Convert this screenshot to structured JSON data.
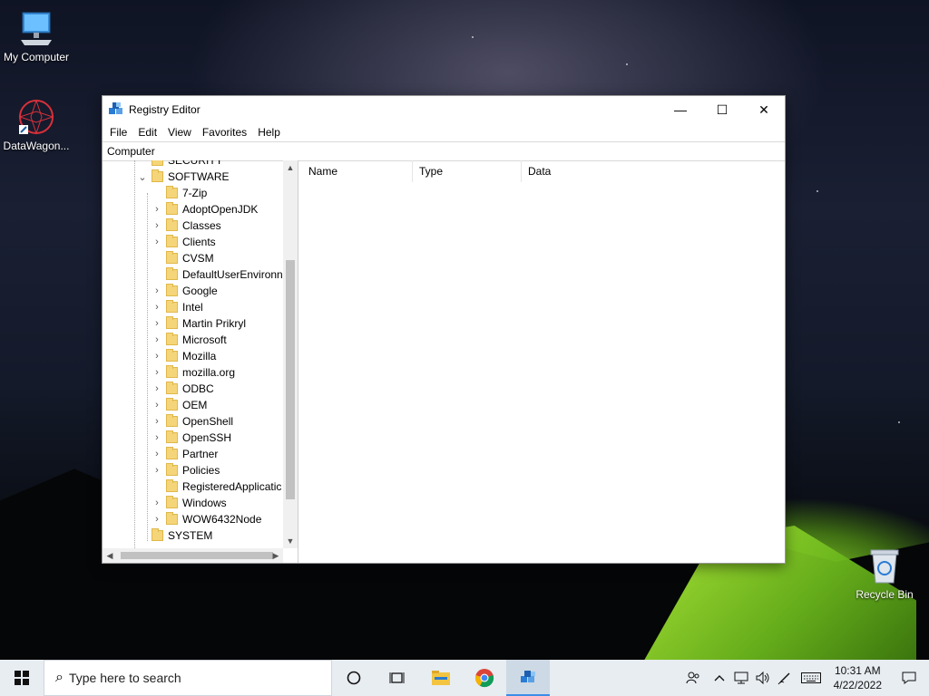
{
  "desktop": {
    "icons": [
      {
        "label": "My Computer",
        "icon": "computer-icon"
      },
      {
        "label": "DataWagon...",
        "icon": "datawagon-icon"
      },
      {
        "label": "Recycle Bin",
        "icon": "recycle-bin-icon"
      }
    ]
  },
  "window": {
    "title": "Registry Editor",
    "controls": {
      "minimize": "—",
      "maximize": "☐",
      "close": "✕"
    },
    "menu": [
      "File",
      "Edit",
      "View",
      "Favorites",
      "Help"
    ],
    "address": "Computer",
    "tree": [
      {
        "label": "SECURITY",
        "level": 1,
        "expander": ""
      },
      {
        "label": "SOFTWARE",
        "level": 1,
        "expander": "⌄"
      },
      {
        "label": "7-Zip",
        "level": 2,
        "expander": ""
      },
      {
        "label": "AdoptOpenJDK",
        "level": 2,
        "expander": "›"
      },
      {
        "label": "Classes",
        "level": 2,
        "expander": "›"
      },
      {
        "label": "Clients",
        "level": 2,
        "expander": "›"
      },
      {
        "label": "CVSM",
        "level": 2,
        "expander": ""
      },
      {
        "label": "DefaultUserEnvironn",
        "level": 2,
        "expander": ""
      },
      {
        "label": "Google",
        "level": 2,
        "expander": "›"
      },
      {
        "label": "Intel",
        "level": 2,
        "expander": "›"
      },
      {
        "label": "Martin Prikryl",
        "level": 2,
        "expander": "›"
      },
      {
        "label": "Microsoft",
        "level": 2,
        "expander": "›"
      },
      {
        "label": "Mozilla",
        "level": 2,
        "expander": "›"
      },
      {
        "label": "mozilla.org",
        "level": 2,
        "expander": "›"
      },
      {
        "label": "ODBC",
        "level": 2,
        "expander": "›"
      },
      {
        "label": "OEM",
        "level": 2,
        "expander": "›"
      },
      {
        "label": "OpenShell",
        "level": 2,
        "expander": "›"
      },
      {
        "label": "OpenSSH",
        "level": 2,
        "expander": "›"
      },
      {
        "label": "Partner",
        "level": 2,
        "expander": "›"
      },
      {
        "label": "Policies",
        "level": 2,
        "expander": "›"
      },
      {
        "label": "RegisteredApplicatic",
        "level": 2,
        "expander": ""
      },
      {
        "label": "Windows",
        "level": 2,
        "expander": "›"
      },
      {
        "label": "WOW6432Node",
        "level": 2,
        "expander": "›"
      },
      {
        "label": "SYSTEM",
        "level": 1,
        "expander": ""
      }
    ],
    "columns": [
      "Name",
      "Type",
      "Data"
    ]
  },
  "taskbar": {
    "search_placeholder": "Type here to search",
    "time": "10:31 AM",
    "date": "4/22/2022",
    "apps": [
      "cortana-icon",
      "task-view-icon",
      "file-explorer-icon",
      "chrome-icon",
      "registry-editor-icon"
    ],
    "tray": [
      "people-icon",
      "chevron-up-icon",
      "network-icon",
      "volume-icon",
      "pen-icon",
      "keyboard-icon",
      "notifications-icon"
    ]
  },
  "colors": {
    "accent": "#3b8ee8",
    "folder": "#f5d57a",
    "taskbar": "#e8edf2"
  }
}
